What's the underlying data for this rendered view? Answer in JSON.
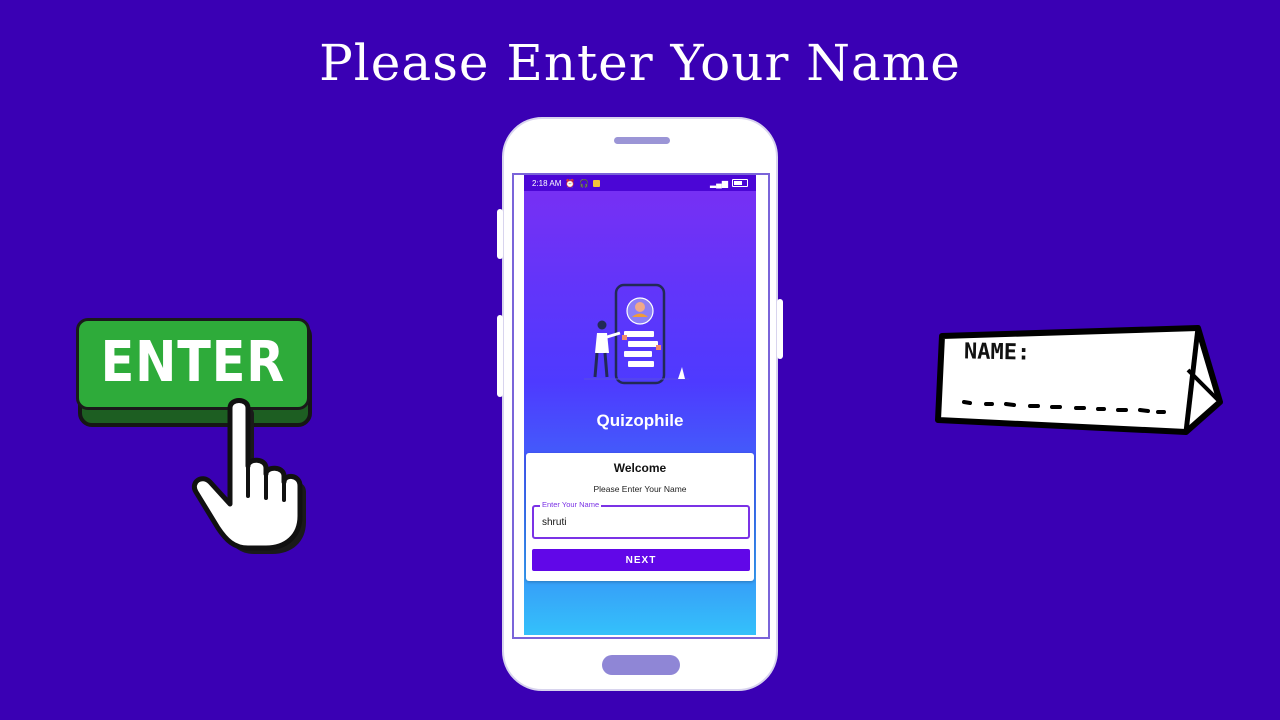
{
  "headline": "Please Enter Your Name",
  "enter_graphic": {
    "label": "ENTER"
  },
  "name_tag": {
    "label": "NAME:"
  },
  "phone": {
    "status_bar": {
      "time": "2:18 AM"
    },
    "app": {
      "title": "Quizophile",
      "card": {
        "title": "Welcome",
        "subtitle": "Please Enter Your Name",
        "name_field": {
          "label": "Enter Your Name",
          "value": "shruti"
        },
        "next_button": "NEXT"
      }
    }
  },
  "colors": {
    "background": "#3a00b4",
    "accent": "#6107e8",
    "enter_green": "#2eab3a"
  },
  "icons": [
    "hand-pointer-icon",
    "alarm-icon",
    "headphones-icon",
    "notification-icon",
    "signal-icon",
    "battery-icon",
    "quiz-person-illustration"
  ]
}
